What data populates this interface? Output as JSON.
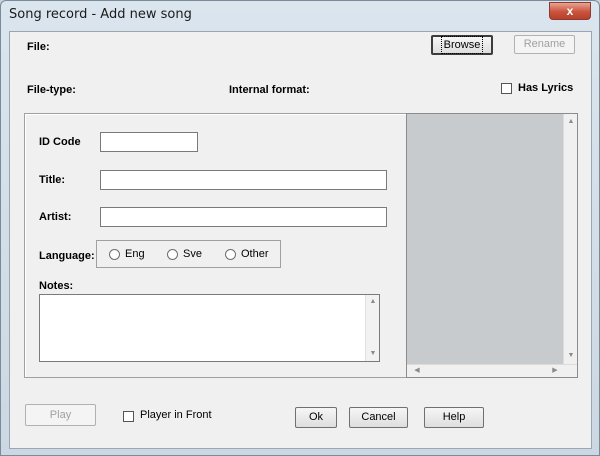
{
  "window": {
    "title": "Song record - Add new song",
    "close_label": "x"
  },
  "file": {
    "label": "File:",
    "browse_label": "Browse",
    "rename_label": "Rename"
  },
  "info": {
    "filetype_label": "File-type:",
    "internal_format_label": "Internal format:",
    "has_lyrics_label": "Has Lyrics",
    "has_lyrics_checked": false
  },
  "form": {
    "id_code_label": "ID Code",
    "id_code_value": "",
    "title_label": "Title:",
    "title_value": "",
    "artist_label": "Artist:",
    "artist_value": "",
    "language_label": "Language:",
    "languages": [
      "Eng",
      "Sve",
      "Other"
    ],
    "notes_label": "Notes:",
    "notes_value": ""
  },
  "footer": {
    "play_label": "Play",
    "player_in_front_label": "Player in Front",
    "player_in_front_checked": false,
    "ok_label": "Ok",
    "cancel_label": "Cancel",
    "help_label": "Help"
  },
  "icons": {
    "scroll_up": "▲",
    "scroll_down": "▼",
    "scroll_left": "◀",
    "scroll_right": "▶"
  },
  "colors": {
    "preview_bg": "#c8cbcd",
    "close_button": "#c9533d"
  }
}
